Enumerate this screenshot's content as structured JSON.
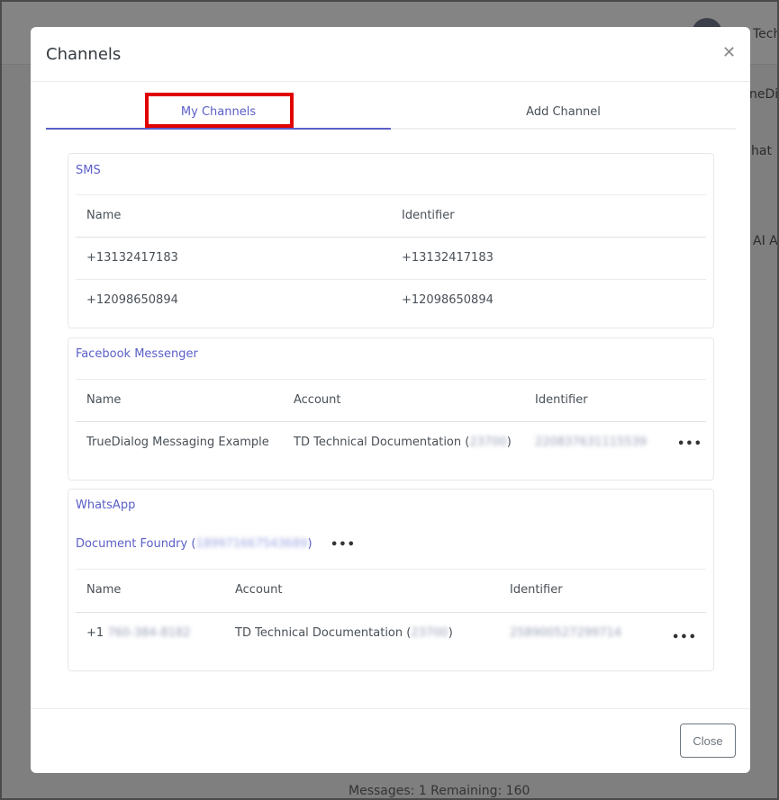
{
  "background": {
    "user_label": "Tech",
    "side_text_1": "neDia",
    "side_text_2": "hat",
    "side_text_3": "AI A",
    "status": "Messages: 1 Remaining: 160"
  },
  "modal": {
    "title": "Channels",
    "close_icon": "close-icon",
    "tabs": [
      {
        "label": "My Channels",
        "active": true
      },
      {
        "label": "Add Channel",
        "active": false
      }
    ],
    "highlight_color": "#e00000",
    "accent_color": "#5a5fc7",
    "sms": {
      "title": "SMS",
      "headers": [
        "Name",
        "Identifier"
      ],
      "rows": [
        [
          "+13132417183",
          "+13132417183"
        ],
        [
          "+12098650894",
          "+12098650894"
        ]
      ]
    },
    "facebook": {
      "title": "Facebook Messenger",
      "headers": [
        "Name",
        "Account",
        "Identifier"
      ],
      "rows": [
        {
          "name": "TrueDialog Messaging Example",
          "account_prefix": "TD Technical Documentation (",
          "account_id": "23700",
          "account_suffix": ")",
          "identifier": "220837631115539"
        }
      ]
    },
    "whatsapp": {
      "title": "WhatsApp",
      "business_prefix": "Document Foundry (",
      "business_id": "189971667543689",
      "business_suffix": ")",
      "headers": [
        "Name",
        "Account",
        "Identifier"
      ],
      "rows": [
        {
          "name_prefix": "+1",
          "name_rest": "760-384-8182",
          "account_prefix": "TD Technical Documentation (",
          "account_id": "23700",
          "account_suffix": ")",
          "identifier": "258900527299714"
        }
      ]
    },
    "more_label": "•••",
    "footer": {
      "close_label": "Close"
    }
  }
}
